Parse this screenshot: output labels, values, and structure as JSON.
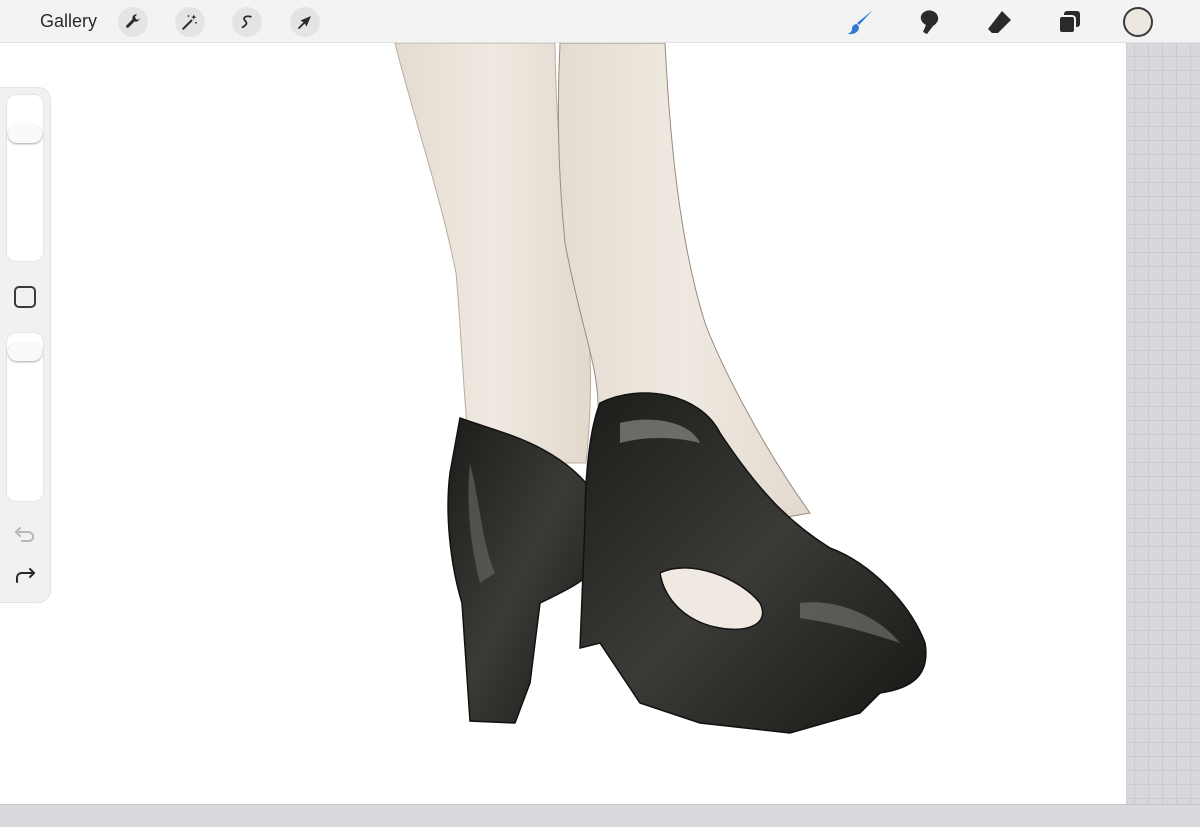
{
  "toolbar": {
    "gallery_label": "Gallery",
    "left_tools": [
      {
        "icon": "wrench-icon",
        "name": "actions"
      },
      {
        "icon": "magic-wand-icon",
        "name": "adjustments"
      },
      {
        "icon": "selection-icon",
        "name": "selection"
      },
      {
        "icon": "transform-arrow-icon",
        "name": "transform"
      }
    ],
    "right_tools": [
      {
        "icon": "brush-icon",
        "name": "paint",
        "active": true
      },
      {
        "icon": "smudge-icon",
        "name": "smudge",
        "active": false
      },
      {
        "icon": "eraser-icon",
        "name": "eraser",
        "active": false
      },
      {
        "icon": "layers-icon",
        "name": "layers",
        "active": false
      }
    ],
    "current_color": "#ece7df"
  },
  "colors": {
    "active_tool": "#2f7bd6",
    "toolbar_bg": "#f3f3f3",
    "icon_dark": "#2a2a2a",
    "skin": "#efe9e1",
    "shoe": "#2a2a27"
  },
  "sidebar": {
    "brush_size_level": 0.8,
    "brush_opacity_level": 0.94,
    "undo_enabled": false,
    "redo_enabled": true
  }
}
